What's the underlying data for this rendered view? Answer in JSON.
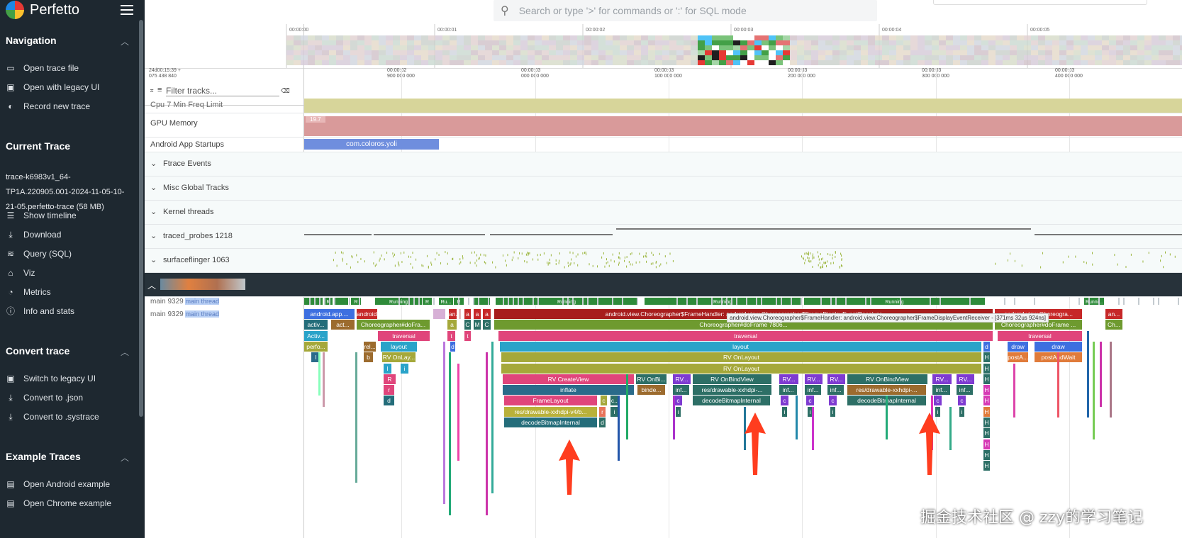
{
  "app": {
    "name": "Perfetto"
  },
  "search": {
    "placeholder": "Search or type '>' for commands or ':' for SQL mode"
  },
  "sidebar": {
    "navigation": {
      "title": "Navigation",
      "items": [
        {
          "label": "Open trace file",
          "icon": "folder-icon"
        },
        {
          "label": "Open with legacy UI",
          "icon": "legacy-icon"
        },
        {
          "label": "Record new trace",
          "icon": "record-icon"
        }
      ]
    },
    "current_trace": {
      "title": "Current Trace",
      "trace_name": "trace-k6983v1_64-TP1A.220905.001-2024-11-05-10-21-05.perfetto-trace (58 MB)",
      "items": [
        {
          "label": "Show timeline",
          "icon": "timeline-icon"
        },
        {
          "label": "Download",
          "icon": "download-icon"
        },
        {
          "label": "Query (SQL)",
          "icon": "database-icon"
        },
        {
          "label": "Viz",
          "icon": "viz-icon"
        },
        {
          "label": "Metrics",
          "icon": "metrics-icon"
        },
        {
          "label": "Info and stats",
          "icon": "info-icon"
        }
      ]
    },
    "convert": {
      "title": "Convert trace",
      "items": [
        {
          "label": "Switch to legacy UI",
          "icon": "switch-icon"
        },
        {
          "label": "Convert to .json",
          "icon": "download-icon"
        },
        {
          "label": "Convert to .systrace",
          "icon": "download-icon"
        }
      ]
    },
    "examples": {
      "title": "Example Traces",
      "items": [
        {
          "label": "Open Android example",
          "icon": "file-icon"
        },
        {
          "label": "Open Chrome example",
          "icon": "file-icon"
        }
      ]
    }
  },
  "overview_ticks": [
    "00:00:00",
    "00:00:01",
    "00:00:02",
    "00:00:03",
    "00:00:04",
    "00:00:05"
  ],
  "timeline": {
    "origin": [
      "24d00:15:39 +",
      "075 438 840"
    ],
    "ticks": [
      [
        "00:00:02",
        "900 000 000"
      ],
      [
        "00:00:03",
        "000 000 000"
      ],
      [
        "00:00:03",
        "100 000 000"
      ],
      [
        "00:00:03",
        "200 000 000"
      ],
      [
        "00:00:03",
        "300 000 000"
      ],
      [
        "00:00:03",
        "400 000 000"
      ]
    ],
    "filter_placeholder": "Filter tracks..."
  },
  "tracks": {
    "cpu_freq": "Cpu 7 Min Freq Limit",
    "gpu_mem": "GPU Memory",
    "gpu_value": "19.7",
    "startups": "Android App Startups",
    "startup_slice": "com.coloros.yoli",
    "ftrace": "Ftrace Events",
    "misc": "Misc Global Tracks",
    "kernel": "Kernel threads",
    "traced": "traced_probes 1218",
    "sf": "surfaceflinger 1063",
    "main1": "main 9329",
    "main2": "main 9329",
    "main_tag": "main thread"
  },
  "state_labels": {
    "running": "Running",
    "r": "R",
    "ru": "Ru..."
  },
  "slices": {
    "big": "android.view.Choreographer$FrameHandler: android.view.Choreographer$FrameDisplayEventReceiver",
    "tooltip": "android.view.Choreographer$FrameHandler: android.view.Choreographer$FrameDisplayEventReceiver - [371ms 32us 924ns]",
    "doframe": "Choreographer#doFrame 7806...",
    "doframe_short": "Choreographer#doFra...",
    "traversal": "traversal",
    "layout": "layout",
    "rv_onlayout": "RV OnLayout",
    "rv_create": "RV CreateView",
    "rv_onbind": "RV OnBindView",
    "rv_onbind_short": "RV OnBi...",
    "inflate": "inflate",
    "framelayout": "FrameLayout",
    "res_v4": "res/drawable-xxhdpi-v4/b...",
    "res": "res/drawable-xxhdpi-...",
    "decode": "decodeBitmapInternal",
    "android_app": "android.app....",
    "choreo_short": "android.view.Choreo...",
    "activ": "activ...",
    "act": "act...",
    "activ2": "Activ...",
    "perfo": "perfo...",
    "rel": "rel...",
    "rv_onlay_short": "RV OnLay...",
    "binde": "binde...",
    "inf": "inf...",
    "draw": "draw",
    "post_a": "postA...",
    "post_wait": "postAndWait",
    "choreo_right": "android.view.Choreogra...",
    "doframe_right": "Choreographer#doFrame ...",
    "an": "an...",
    "ch": "Ch..."
  },
  "watermark": "掘金技术社区 @ zzy的学习笔记",
  "colors": {
    "sidebar": "#1e2830",
    "accent_red": "#ff3d1f"
  }
}
